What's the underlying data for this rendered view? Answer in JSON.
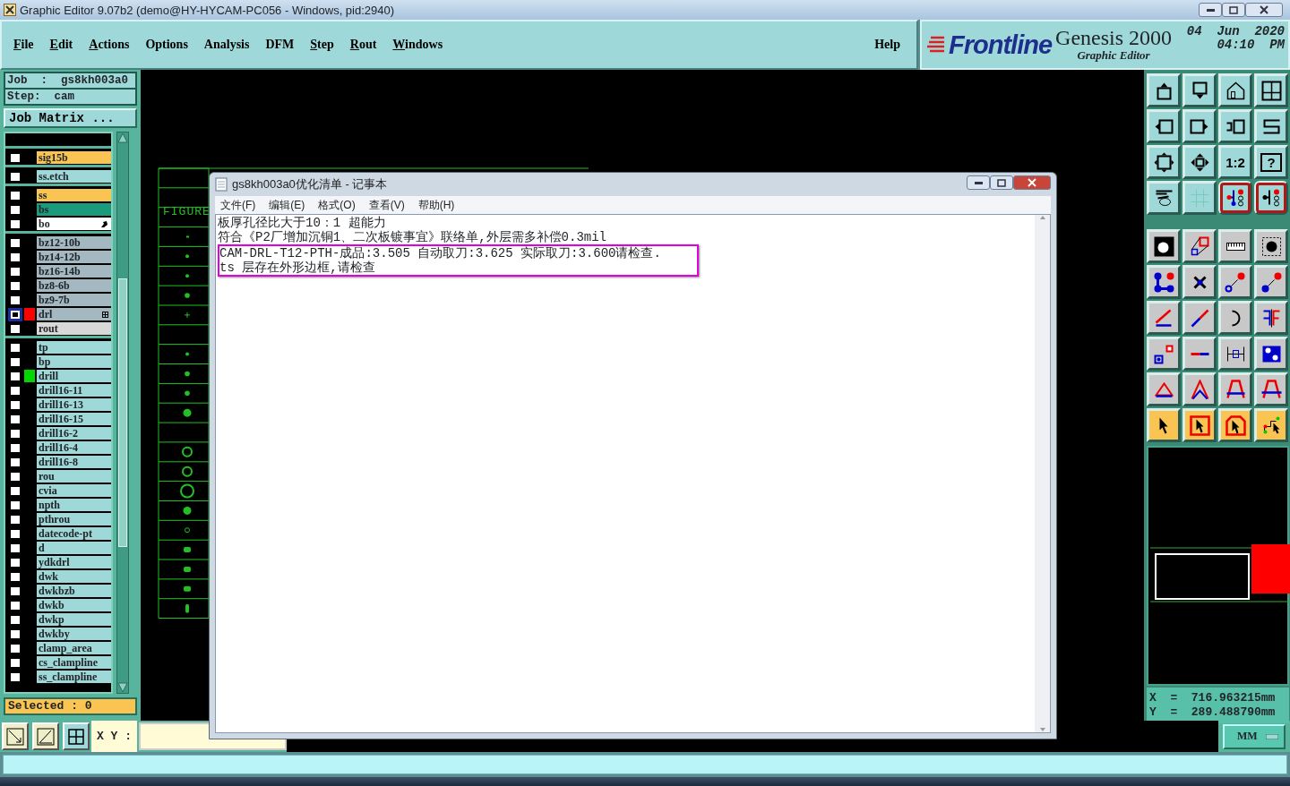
{
  "window": {
    "title": "Graphic Editor 9.07b2 (demo@HY-HYCAM-PC056 - Windows, pid:2940)"
  },
  "menu": [
    {
      "label": "File",
      "mnemonic": true
    },
    {
      "label": "Edit",
      "mnemonic": true
    },
    {
      "label": "Actions",
      "mnemonic": true
    },
    {
      "label": "Options",
      "mnemonic": false
    },
    {
      "label": "Analysis",
      "mnemonic": false
    },
    {
      "label": "DFM",
      "mnemonic": false
    },
    {
      "label": "Step",
      "mnemonic": true
    },
    {
      "label": "Rout",
      "mnemonic": true
    },
    {
      "label": "Windows",
      "mnemonic": true
    }
  ],
  "help_menu": {
    "label": "Help",
    "mnemonic": false
  },
  "brand": {
    "logo": "Frontline",
    "product": "Genesis 2000",
    "subtitle": "Graphic Editor",
    "date": "04  Jun  2020",
    "time": "04:10  PM"
  },
  "job": {
    "job": "Job  :  gs8kh003a0",
    "step": "Step:  cam",
    "matrix_button": "Job Matrix ...",
    "selected": "Selected : 0"
  },
  "layer_groups": [
    [
      {
        "name": "sig15b",
        "color": "#f9c452",
        "selected": false
      }
    ],
    [
      {
        "name": "ss.etch",
        "color": "#9fd8d8",
        "selected": false
      }
    ],
    [
      {
        "name": "ss",
        "color": "#f9c452",
        "selected": false
      },
      {
        "name": "bs",
        "color": "#1a9c7c",
        "selected": false
      },
      {
        "name": "bo",
        "color": "#ffffff",
        "selected": false,
        "kind": "pointer"
      }
    ],
    [
      {
        "name": "bz12-10b",
        "color": "#a3b8c0",
        "selected": false
      },
      {
        "name": "bz14-12b",
        "color": "#a3b8c0",
        "selected": false
      },
      {
        "name": "bz16-14b",
        "color": "#a3b8c0",
        "selected": false
      },
      {
        "name": "bz8-6b",
        "color": "#a3b8c0",
        "selected": false
      },
      {
        "name": "bz9-7b",
        "color": "#a3b8c0",
        "selected": false
      },
      {
        "name": "drl",
        "color": "#a3b8c0",
        "swatch": {
          "color": "#ff0000"
        },
        "selected": true,
        "kind": "grid"
      },
      {
        "name": "rout",
        "color": "#d8d8d8",
        "selected": false
      }
    ],
    [
      {
        "name": "tp",
        "color": "#9fd8d8",
        "selected": false
      },
      {
        "name": "bp",
        "color": "#9fd8d8",
        "selected": false
      },
      {
        "name": "drill",
        "color": "#9fd8d8",
        "swatch": {
          "color": "#00d800"
        },
        "selected": false
      },
      {
        "name": "drill16-11",
        "color": "#9fd8d8",
        "selected": false
      },
      {
        "name": "drill16-13",
        "color": "#9fd8d8",
        "selected": false
      },
      {
        "name": "drill16-15",
        "color": "#9fd8d8",
        "selected": false
      },
      {
        "name": "drill16-2",
        "color": "#9fd8d8",
        "selected": false
      },
      {
        "name": "drill16-4",
        "color": "#9fd8d8",
        "selected": false
      },
      {
        "name": "drill16-8",
        "color": "#9fd8d8",
        "selected": false
      },
      {
        "name": "rou",
        "color": "#9fd8d8",
        "selected": false
      },
      {
        "name": "cvia",
        "color": "#9fd8d8",
        "selected": false
      },
      {
        "name": "npth",
        "color": "#9fd8d8",
        "selected": false
      },
      {
        "name": "pthrou",
        "color": "#9fd8d8",
        "selected": false
      },
      {
        "name": "datecode-pt",
        "color": "#9fd8d8",
        "selected": false
      },
      {
        "name": "d",
        "color": "#9fd8d8",
        "selected": false
      },
      {
        "name": "ydkdrl",
        "color": "#9fd8d8",
        "selected": false
      },
      {
        "name": "dwk",
        "color": "#9fd8d8",
        "selected": false
      },
      {
        "name": "dwkbzb",
        "color": "#9fd8d8",
        "selected": false
      },
      {
        "name": "dwkb",
        "color": "#9fd8d8",
        "selected": false
      },
      {
        "name": "dwkp",
        "color": "#9fd8d8",
        "selected": false
      },
      {
        "name": "dwkby",
        "color": "#9fd8d8",
        "selected": false
      },
      {
        "name": "clamp_area",
        "color": "#9fd8d8",
        "selected": false
      },
      {
        "name": "cs_clampline",
        "color": "#9fd8d8",
        "selected": false
      },
      {
        "name": "ss_clampline",
        "color": "#9fd8d8",
        "selected": false
      }
    ]
  ],
  "canvas": {
    "column_heading": "FIGURE"
  },
  "notepad": {
    "title": "gs8kh003a0优化清单 - 记事本",
    "menu": [
      "文件(F)",
      "编辑(E)",
      "格式(O)",
      "查看(V)",
      "帮助(H)"
    ],
    "lines": [
      {
        "text": "板厚孔径比大于10：1 超能力",
        "highlighted": false
      },
      {
        "text": "符合《P2厂增加沉铜1、二次板镀事宜》联络单,外层需多补偿0.3mil",
        "highlighted": false
      },
      {
        "text": "CAM-DRL-T12-PTH-成品:3.505 自动取刀:3.625 实际取刀:3.600请检查.",
        "highlighted": true
      },
      {
        "text": "ts 层存在外形边框,请检查",
        "highlighted": true
      }
    ]
  },
  "toolbar": [
    {
      "kind": "teal"
    },
    {
      "kind": "teal"
    },
    {
      "kind": "teal"
    },
    {
      "kind": "teal"
    },
    {
      "kind": "teal"
    },
    {
      "kind": "teal"
    },
    {
      "kind": "teal"
    },
    {
      "kind": "teal"
    },
    {
      "kind": "teal"
    },
    {
      "kind": "teal"
    },
    {
      "kind": "teal",
      "label": "1:2"
    },
    {
      "kind": "teal",
      "label": "?"
    },
    {
      "kind": "teal"
    },
    {
      "kind": "teal"
    },
    {
      "kind": "alert"
    },
    {
      "kind": "alert"
    },
    {
      "kind": "grey"
    },
    {
      "kind": "grey"
    },
    {
      "kind": "grey"
    },
    {
      "kind": "grey"
    },
    {
      "kind": "grey"
    },
    {
      "kind": "grey"
    },
    {
      "kind": "grey"
    },
    {
      "kind": "grey"
    },
    {
      "kind": "grey"
    },
    {
      "kind": "grey"
    },
    {
      "kind": "grey"
    },
    {
      "kind": "grey"
    },
    {
      "kind": "grey"
    },
    {
      "kind": "grey"
    },
    {
      "kind": "grey"
    },
    {
      "kind": "grey"
    },
    {
      "kind": "grey"
    },
    {
      "kind": "grey"
    },
    {
      "kind": "grey"
    },
    {
      "kind": "grey"
    },
    {
      "kind": "orange"
    },
    {
      "kind": "orange"
    },
    {
      "kind": "orange"
    },
    {
      "kind": "orange"
    }
  ],
  "coordinates": {
    "x": "X  =  716.963215mm",
    "y": "Y  =  289.488790mm"
  },
  "xy_label": "X Y :",
  "units": "MM"
}
